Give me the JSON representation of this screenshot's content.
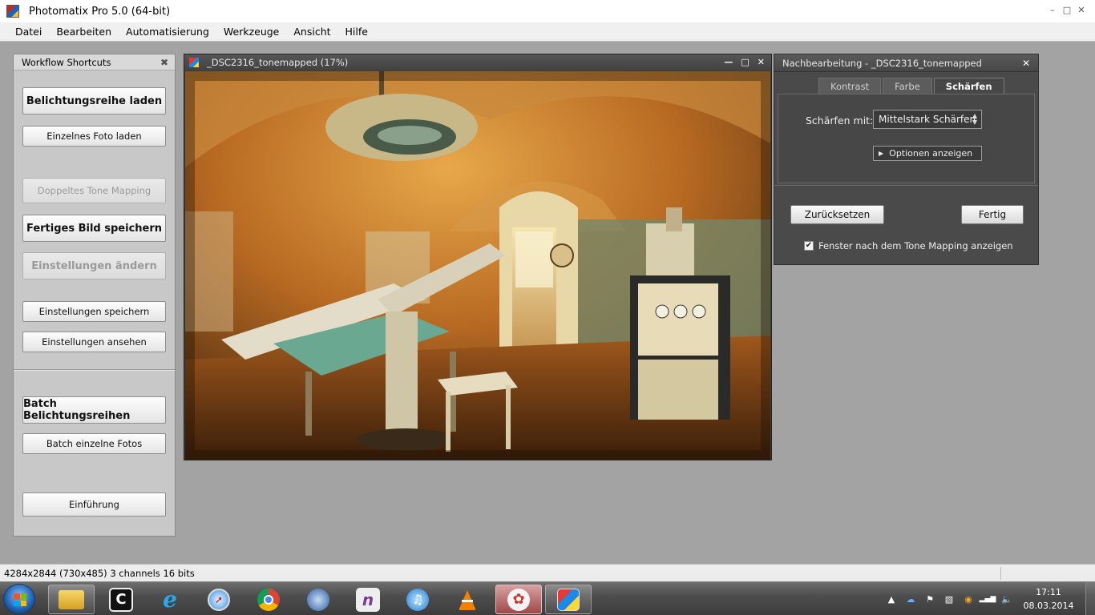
{
  "window": {
    "title": "Photomatix Pro 5.0 (64-bit)",
    "icon": "photomatix-icon"
  },
  "menu": [
    "Datei",
    "Bearbeiten",
    "Automatisierung",
    "Werkzeuge",
    "Ansicht",
    "Hilfe"
  ],
  "workflow": {
    "title": "Workflow Shortcuts",
    "buttons": {
      "load_bracketed": "Belichtungsreihe laden",
      "load_single": "Einzelnes Foto laden",
      "double_tonemap": "Doppeltes Tone Mapping",
      "save_final": "Fertiges Bild speichern",
      "change_settings": "Einstellungen ändern",
      "save_settings": "Einstellungen speichern",
      "view_settings": "Einstellungen ansehen",
      "batch_bracketed": "Batch Belichtungsreihen",
      "batch_single": "Batch einzelne Fotos",
      "intro": "Einführung"
    }
  },
  "image_window": {
    "title": "_DSC2316_tonemapped (17%)"
  },
  "post_processing": {
    "title": "Nachbearbeitung - _DSC2316_tonemapped",
    "tabs": [
      "Kontrast",
      "Farbe",
      "Schärfen"
    ],
    "active_tab": "Schärfen",
    "sharpen_label": "Schärfen mit:",
    "sharpen_value": "Mittelstark Schärfen",
    "options_button": "Optionen anzeigen",
    "reset_button": "Zurücksetzen",
    "done_button": "Fertig",
    "checkbox_label": "Fenster nach dem Tone Mapping anzeigen",
    "checkbox_checked": true
  },
  "status_bar": {
    "text": "4284x2844 (730x485) 3 channels 16 bits"
  },
  "taskbar": {
    "apps": [
      "file-explorer-icon",
      "app-c-icon",
      "internet-explorer-icon",
      "safari-icon",
      "chrome-icon",
      "thunderbird-icon",
      "onenote-icon",
      "itunes-icon",
      "vlc-icon",
      "photo-app-icon",
      "photomatix-icon"
    ],
    "clock_time": "17:11",
    "clock_date": "08.03.2014"
  }
}
